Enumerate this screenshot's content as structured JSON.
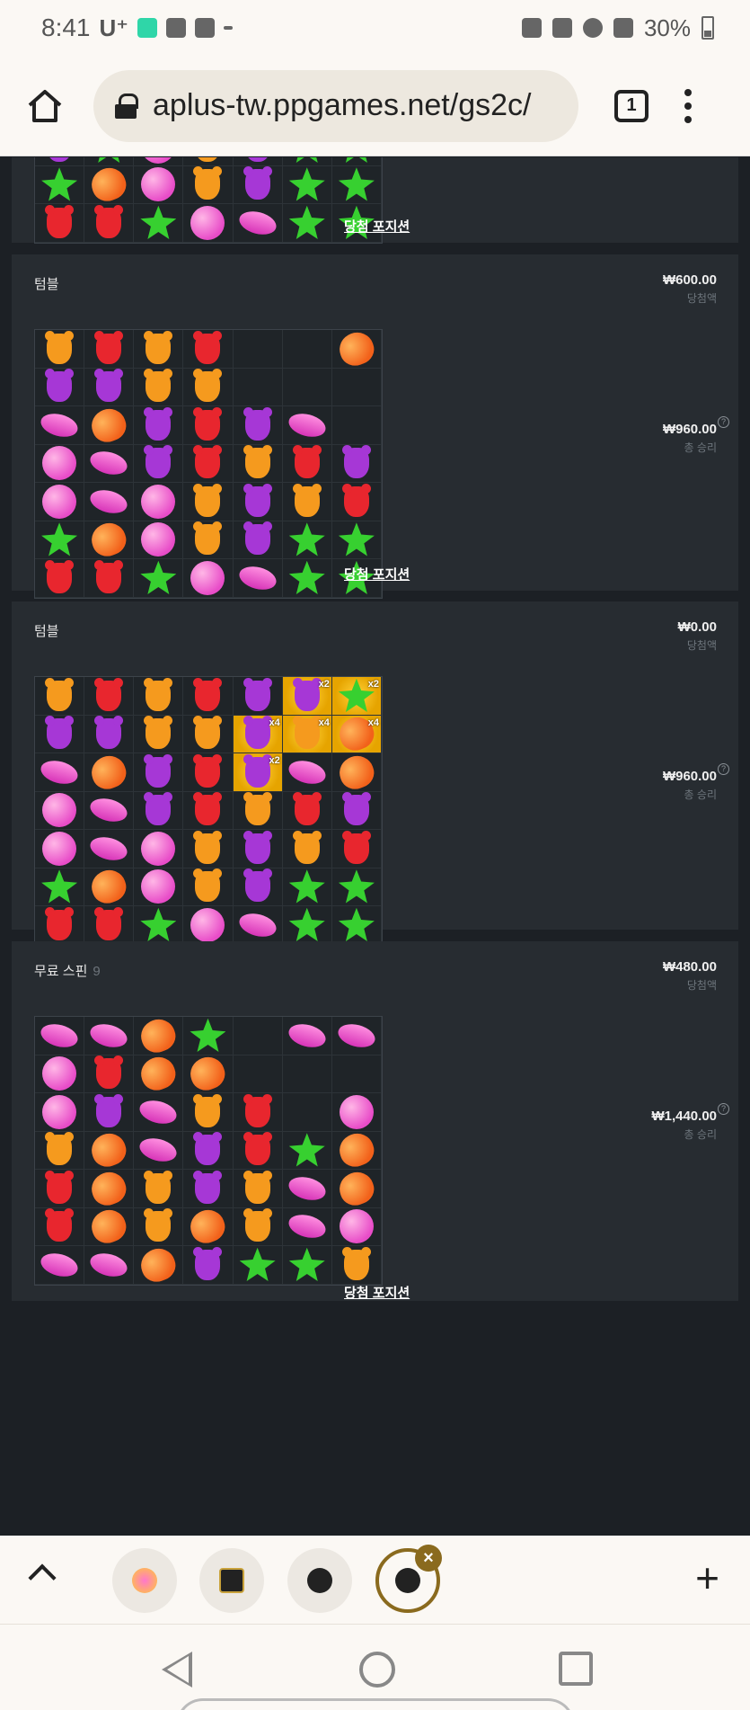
{
  "status_bar": {
    "time": "8:41",
    "carrier": "U⁺",
    "battery": "30%"
  },
  "browser": {
    "url": "aplus-tw.ppgames.net/gs2c/",
    "tab_count": "1"
  },
  "cards": [
    {
      "win_link": "당첨 포지션",
      "rows": [
        [
          "bear-purple",
          "star",
          "lolli",
          "bear-orange",
          "bear-purple",
          "star",
          "star"
        ],
        [
          "star",
          "heart",
          "lolli",
          "bear-orange",
          "bear-purple",
          "star",
          "star"
        ],
        [
          "bear-red",
          "bear-red",
          "star",
          "lolli",
          "bean",
          "star",
          "star"
        ]
      ]
    },
    {
      "title": "텀블",
      "amount": "₩600.00",
      "amount_label": "당첨액",
      "total": "₩960.00",
      "total_label": "총 승리",
      "win_link": "당첨 포지션",
      "rows": [
        [
          "bear-orange",
          "bear-red",
          "bear-orange",
          "bear-red",
          "",
          "",
          "heart"
        ],
        [
          "bear-purple",
          "bear-purple",
          "bear-orange",
          "bear-orange",
          "",
          "",
          ""
        ],
        [
          "bean",
          "heart",
          "bear-purple",
          "bear-red",
          "bear-purple",
          "bean",
          ""
        ],
        [
          "lolli",
          "bean",
          "bear-purple",
          "bear-red",
          "bear-orange",
          "bear-red",
          "bear-purple"
        ],
        [
          "lolli",
          "bean",
          "lolli",
          "bear-orange",
          "bear-purple",
          "bear-orange",
          "bear-red"
        ],
        [
          "star",
          "heart",
          "lolli",
          "bear-orange",
          "bear-purple",
          "star",
          "star"
        ],
        [
          "bear-red",
          "bear-red",
          "star",
          "lolli",
          "bean",
          "star",
          "star"
        ]
      ]
    },
    {
      "title": "텀블",
      "amount": "₩0.00",
      "amount_label": "당첨액",
      "total": "₩960.00",
      "total_label": "총 승리",
      "rows": [
        [
          "bear-orange",
          "bear-red",
          "bear-orange",
          "bear-red",
          "bear-purple",
          "bear-purple|x2",
          "star|x2"
        ],
        [
          "bear-purple",
          "bear-purple",
          "bear-orange",
          "bear-orange",
          "bear-purple|x4",
          "bear-orange|x4",
          "heart|x4"
        ],
        [
          "bean",
          "heart",
          "bear-purple",
          "bear-red",
          "bear-purple|x2",
          "bean",
          "heart"
        ],
        [
          "lolli",
          "bean",
          "bear-purple",
          "bear-red",
          "bear-orange",
          "bear-red",
          "bear-purple"
        ],
        [
          "lolli",
          "bean",
          "lolli",
          "bear-orange",
          "bear-purple",
          "bear-orange",
          "bear-red"
        ],
        [
          "star",
          "heart",
          "lolli",
          "bear-orange",
          "bear-purple",
          "star",
          "star"
        ],
        [
          "bear-red",
          "bear-red",
          "star",
          "lolli",
          "bean",
          "star",
          "star"
        ]
      ]
    },
    {
      "title": "무료 스핀",
      "title_count": "9",
      "amount": "₩480.00",
      "amount_label": "당첨액",
      "total": "₩1,440.00",
      "total_label": "총 승리",
      "win_link": "당첨 포지션",
      "rows": [
        [
          "bean",
          "bean",
          "heart",
          "star",
          "",
          "bean",
          "bean"
        ],
        [
          "lolli",
          "bear-red",
          "heart",
          "heart",
          "",
          "",
          ""
        ],
        [
          "lolli",
          "bear-purple",
          "bean",
          "bear-orange",
          "bear-red",
          "",
          "lolli"
        ],
        [
          "bear-orange",
          "heart",
          "bean",
          "bear-purple",
          "bear-red",
          "star",
          "heart"
        ],
        [
          "bear-red",
          "heart",
          "bear-orange",
          "bear-purple",
          "bear-orange",
          "bean",
          "heart"
        ],
        [
          "bear-red",
          "heart",
          "bear-orange",
          "heart",
          "bear-orange",
          "bean",
          "lolli"
        ],
        [
          "bean",
          "bean",
          "heart",
          "bear-purple",
          "star",
          "star",
          "bear-orange"
        ]
      ]
    }
  ],
  "tab_strip": {
    "tabs": [
      {
        "icon": "candy-game-icon"
      },
      {
        "icon": "home-casino-icon"
      },
      {
        "icon": "globe-icon"
      },
      {
        "icon": "globe-icon",
        "active": true
      }
    ]
  }
}
